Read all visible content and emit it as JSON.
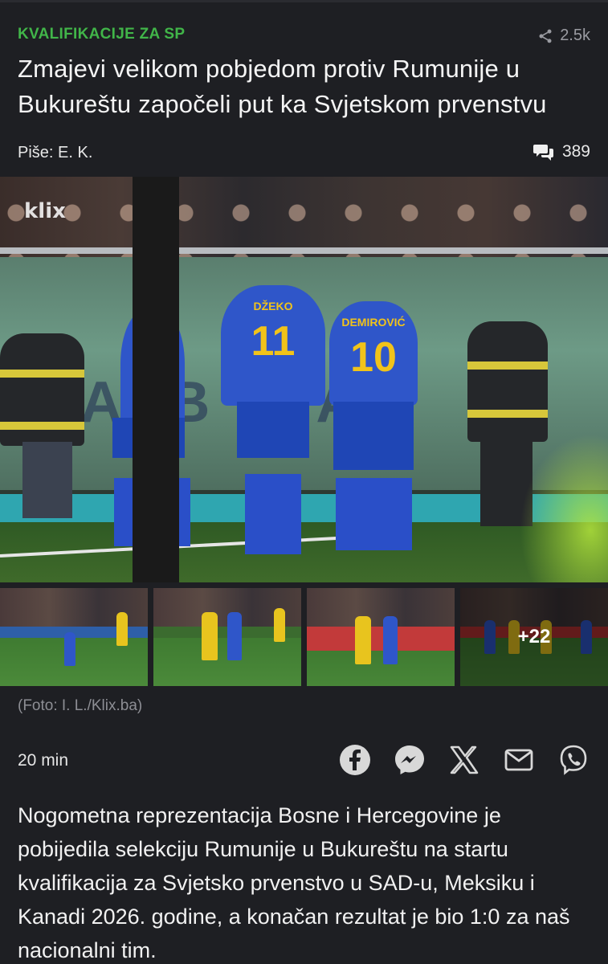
{
  "article": {
    "category": "KVALIFIKACIJE ZA SP",
    "share_count": "2.5k",
    "title": "Zmajevi velikom pobjedom protiv Rumunije u Bukureštu započeli put ka Svjetskom prvenstvu",
    "author": "Piše: E. K.",
    "comment_count": "389",
    "photo_caption": "(Foto: I. L./Klix.ba)",
    "time_ago": "20 min",
    "lead": "Nogometna reprezentacija Bosne i Hercegovine je pobijedila selekciju Rumunije u Bukureštu na startu kvalifikacija za Svjetsko prvenstvo u SAD-u, Meksiku i Kanadi 2026. godine, a konačan rezultat je bio 1:0 za naš nacionalni tim."
  },
  "hero_photo": {
    "watermark": "klix",
    "board_text": "A    B    NA",
    "jersey_left_name": "DŽEKO",
    "jersey_left_number": "11",
    "jersey_right_name": "DEMIROVIĆ",
    "jersey_right_number": "10"
  },
  "gallery": {
    "more_label": "+22"
  },
  "share_buttons": [
    {
      "icon": "facebook-icon"
    },
    {
      "icon": "messenger-icon"
    },
    {
      "icon": "x-icon"
    },
    {
      "icon": "mail-icon"
    },
    {
      "icon": "viber-icon"
    }
  ],
  "colors": {
    "background": "#1e1f23",
    "category": "#41b549",
    "muted": "#8d8e94",
    "jersey": "#2f56c9",
    "jersey_number": "#f1c31a"
  }
}
